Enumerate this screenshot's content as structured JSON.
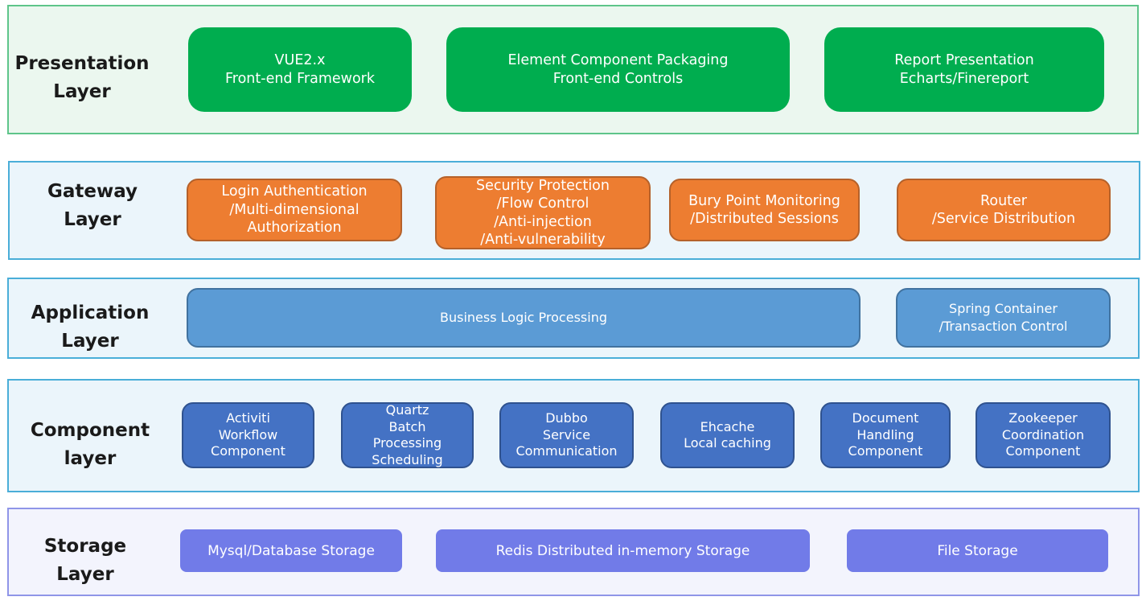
{
  "diagram": {
    "type": "layered-architecture",
    "layers": [
      {
        "id": "presentation",
        "title": "Presentation\nLayer",
        "color": "#00ad4f",
        "items": [
          {
            "label": "VUE2.x\nFront-end Framework"
          },
          {
            "label": "Element Component Packaging\nFront-end Controls"
          },
          {
            "label": "Report Presentation\nEcharts/Finereport"
          }
        ]
      },
      {
        "id": "gateway",
        "title": "Gateway Layer",
        "color": "#ed7d31",
        "items": [
          {
            "label": "Login Authentication\n/Multi-dimensional\nAuthorization"
          },
          {
            "label": "Security Protection\n/Flow Control\n/Anti-injection\n/Anti-vulnerability"
          },
          {
            "label": "Bury Point Monitoring\n/Distributed Sessions"
          },
          {
            "label": "Router\n/Service Distribution"
          }
        ]
      },
      {
        "id": "application",
        "title": "Application\nLayer",
        "color": "#5b9bd5",
        "items": [
          {
            "label": "Business Logic Processing"
          },
          {
            "label": "Spring Container\n/Transaction Control"
          }
        ]
      },
      {
        "id": "component",
        "title": "Component\nlayer",
        "color": "#4472c4",
        "items": [
          {
            "label": "Activiti\nWorkflow\nComponent"
          },
          {
            "label": "Quartz\nBatch\nProcessing\nScheduling"
          },
          {
            "label": "Dubbo\nService\nCommunication"
          },
          {
            "label": "Ehcache\nLocal caching"
          },
          {
            "label": "Document\nHandling\nComponent"
          },
          {
            "label": "Zookeeper\nCoordination\nComponent"
          }
        ]
      },
      {
        "id": "storage",
        "title": "Storage\nLayer",
        "color": "#717be8",
        "items": [
          {
            "label": "Mysql/Database Storage"
          },
          {
            "label": "Redis Distributed in-memory Storage"
          },
          {
            "label": "File Storage"
          }
        ]
      }
    ]
  }
}
